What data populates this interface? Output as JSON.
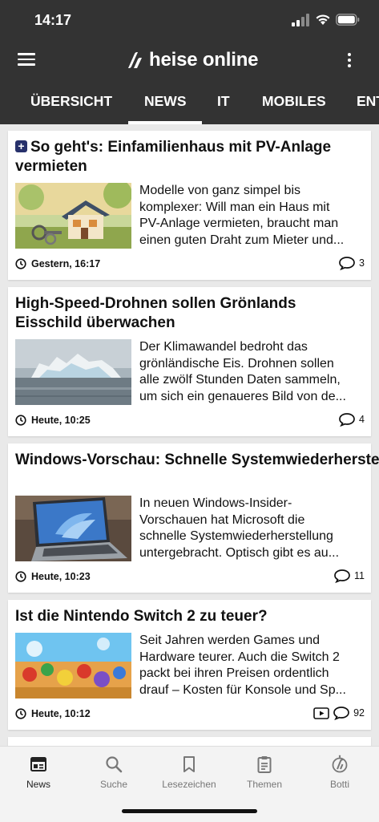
{
  "status_bar": {
    "time": "14:17"
  },
  "header": {
    "logo_text": "heise online"
  },
  "tabs": [
    {
      "label": "ÜBERSICHT"
    },
    {
      "label": "NEWS",
      "active": true
    },
    {
      "label": "IT"
    },
    {
      "label": "MOBILES"
    },
    {
      "label": "ENT"
    }
  ],
  "articles": [
    {
      "badge": "+",
      "title": "So geht's: Einfamilienhaus mit PV-Anlage vermieten",
      "teaser": [
        "Modelle von ganz simpel bis",
        "komplexer: Will man ein Haus mit",
        "PV-Anlage vermieten, braucht man",
        "einen guten Draht zum Mieter und..."
      ],
      "time": "Gestern, 16:17",
      "comments": "3"
    },
    {
      "title": "High-Speed-Drohnen sollen Grönlands Eisschild überwachen",
      "teaser": [
        "Der Klimawandel bedroht das",
        "grönländische Eis. Drohnen sollen",
        "alle zwölf Stunden Daten sammeln,",
        "um sich ein genaueres Bild von de..."
      ],
      "time": "Heute, 10:25",
      "comments": "4"
    },
    {
      "title": "Windows-Vorschau: Schnelle Systemwiederherstellung und überarbeitetes...",
      "teaser": [
        "In neuen Windows-Insider-",
        "Vorschauen hat Microsoft die",
        "schnelle Systemwiederherstellung",
        "untergebracht. Optisch gibt es au..."
      ],
      "time": "Heute, 10:23",
      "comments": "11"
    },
    {
      "title": "Ist die Nintendo Switch 2 zu teuer?",
      "teaser": [
        "Seit Jahren werden Games und",
        "Hardware teurer. Auch die Switch 2",
        "packt bei ihren Preisen ordentlich",
        "drauf – Kosten für Konsole und Sp..."
      ],
      "time": "Heute, 10:12",
      "comments": "92",
      "has_video": true
    }
  ],
  "bottom_nav": [
    {
      "label": "News",
      "icon": "news-icon",
      "active": true
    },
    {
      "label": "Suche",
      "icon": "search-icon"
    },
    {
      "label": "Lesezeichen",
      "icon": "bookmark-icon"
    },
    {
      "label": "Themen",
      "icon": "topics-icon"
    },
    {
      "label": "Botti",
      "icon": "botti-icon"
    }
  ],
  "colors": {
    "header_bg": "#333333",
    "plus_badge": "#27316b",
    "feed_bg": "#e9e9e9"
  }
}
